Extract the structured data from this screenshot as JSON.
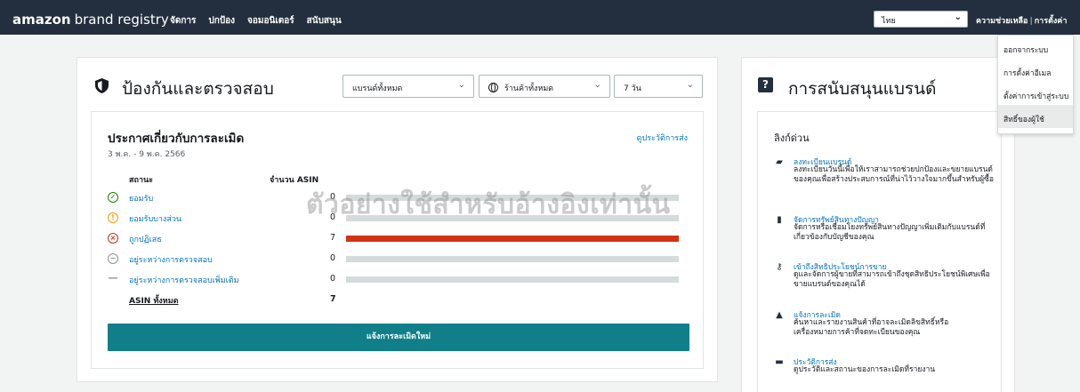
{
  "header": {
    "logo_bold": "amazon",
    "logo_rest": "brand registry",
    "nav": [
      "จัดการ",
      "ปกป้อง",
      "จอมอนิเตอร์",
      "สนับสนุน"
    ],
    "language": "ไทย",
    "help": "ความช่วยเหลือ",
    "settings": "การตั้งค่า"
  },
  "settings_menu": {
    "items": [
      "ออกจากระบบ",
      "การตั้งค่าอีเมล",
      "ตั้งค่าการเข้าสู่ระบบ",
      "สิทธิ์ของผู้ใช้"
    ],
    "active_index": 3
  },
  "protect": {
    "title": "ป้องกันและตรวจสอบ",
    "brand_select": "แบรนด์ทั้งหมด",
    "store_select": "ร้านค้าทั้งหมด",
    "period_select": "7 วัน",
    "notice": {
      "title": "ประกาศเกี่ยวกับการละเมิด",
      "date_range": "3 พ.ค. - 9 พ.ค. 2566",
      "history_link": "ดูประวัติการส่ง",
      "col_status": "สถานะ",
      "col_count": "จำนวน ASIN",
      "rows": [
        {
          "label": "ยอมรับ",
          "count": "0",
          "fraction": 0
        },
        {
          "label": "ยอมรับบางส่วน",
          "count": "0",
          "fraction": 0
        },
        {
          "label": "ถูกปฏิเสธ",
          "count": "7",
          "fraction": 1
        },
        {
          "label": "อยู่ระหว่างการตรวจสอบ",
          "count": "0",
          "fraction": 0
        },
        {
          "label": "อยู่ระหว่างการตรวจสอบเพิ่มเติม",
          "count": "0",
          "fraction": 0
        }
      ],
      "total_label": "ASIN ทั้งหมด",
      "total_count": "7",
      "report_button": "แจ้งการละเมิดใหม่"
    }
  },
  "watermark": "ตัวอย่างใช้สำหรับอ้างอิงเท่านั้น",
  "support": {
    "title": "การสนับสนุนแบรนด์",
    "quick_links_title": "ลิงก์ด่วน",
    "links": [
      {
        "icon": "folder-plus-icon",
        "title": "ลงทะเบียนแบรนด์",
        "desc": "ลงทะเบียนวันนี้เพื่อให้เราสามารถช่วยปกป้องและขยายแบรนด์ของคุณเพื่อสร้างประสบการณ์ที่น่าไว้วางใจมากขึ้นสำหรับผู้ซื้อ"
      },
      {
        "icon": "document-icon",
        "title": "จัดการทรัพย์สินทางปัญญา",
        "desc": "จัดการหรือเชื่อมโยงทรัพย์สินทางปัญญาเพิ่มเติมกับแบรนด์ที่เกี่ยวข้องกับบัญชีของคุณ"
      },
      {
        "icon": "key-icon",
        "title": "เข้าถึงสิทธิประโยชน์การขาย",
        "desc": "ดูและจัดการผู้ขายที่สามารถเข้าถึงชุดสิทธิประโยชน์พิเศษเพื่อขายแบรนด์ของคุณได้"
      },
      {
        "icon": "warning-icon",
        "title": "แจ้งการละเมิด",
        "desc": "ค้นหาและรายงานสินค้าที่อาจละเมิดลิขสิทธิ์หรือเครื่องหมายการค้าที่จดทะเบียนของคุณ"
      },
      {
        "icon": "folder-icon",
        "title": "ประวัติการส่ง",
        "desc": "ดูประวัติและสถานะของการละเมิดที่รายงาน"
      }
    ]
  },
  "colors": {
    "header_bg": "#232f3e",
    "link": "#0073bb",
    "button": "#107f89",
    "rejected": "#d13212",
    "accepted": "#1d8102",
    "partial": "#ff9900",
    "review": "#879596"
  }
}
